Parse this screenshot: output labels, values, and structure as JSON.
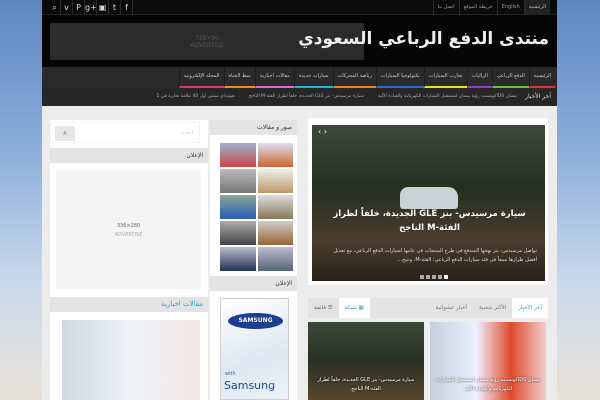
{
  "topbar": {
    "links": [
      "الرئيسية",
      "English",
      "خريطة الموقع",
      "اتصل بنا"
    ],
    "social": [
      "facebook-icon",
      "twitter-icon",
      "youtube-icon",
      "google-plus-icon",
      "pinterest-icon",
      "vimeo-icon",
      "search-icon"
    ]
  },
  "header": {
    "logo": "منتدى الدفع الرباعي السعودي",
    "ad_size": "728×90",
    "ad_label": "ADVERTISE"
  },
  "nav": [
    {
      "label": "الرئيسية",
      "color": "#e0333a"
    },
    {
      "label": "الدفع الرباعي",
      "color": "#6cc04a"
    },
    {
      "label": "الراليات",
      "color": "#8a3fc4"
    },
    {
      "label": "تجارب السيارات",
      "color": "#e8e21e"
    },
    {
      "label": "تكنولوجيا السيارات",
      "color": "#2f69c9"
    },
    {
      "label": "رياضة المحركات",
      "color": "#e88a1e"
    },
    {
      "label": "سيارات جديدة",
      "color": "#1eb8d6"
    },
    {
      "label": "مقالات اخبارية",
      "color": "#e86ad0"
    },
    {
      "label": "نمط الحياة",
      "color": "#f08a1e"
    },
    {
      "label": "المجلة الإلكترونية",
      "color": "#e03366"
    }
  ],
  "ticker": {
    "label": "آخر الأخبار",
    "items": [
      "نيسان IDSكونسبت رؤية نيسان لمستقبل السيارات الكهربائية والقيادة الآلية",
      "سيارة مرسيدس- بنز GLE الجديدة، خلفاً لطراز الفئة-M الناجح",
      "هيونداي سنس أول 40 علامة تجارية في 5"
    ]
  },
  "slider": {
    "title": "سيارة مرسيدس- بنز GLE الجديدة، خلفاً لطراز الفئة-M الناجح",
    "excerpt": "تواصل مرسيدس- بنز نهجها المندفع في طرح المنتجات في عامها لسيارات الدفع الرباعي، مع تعديل أفضل طرازها مبيعاً في فئة سيارات الدفع الرباعي: الفئة-M. وتتيح...",
    "slides": 5,
    "active": 5
  },
  "tabs": {
    "items": [
      "آخر الأخبار",
      "الأكثر شعبية",
      "أخبار عشوائية"
    ],
    "active": 0,
    "views": [
      "شبكة",
      "قائمة"
    ]
  },
  "posts": [
    {
      "title": "نيسان IDSكونسبت رؤية نيسان لمستقبل السيارات الكهربائية والقيادة الآلية"
    },
    {
      "title": "سيارة مرسيدس- بنز GLE الجديدة، خلفاً لطراز الفئة-M الناجح"
    }
  ],
  "middle": {
    "gallery_title": "صور و مقالات",
    "ad_title": "الإعلان",
    "samsung_logo": "SAMSUNG",
    "samsung_with": "with",
    "samsung_brand": "Samsung"
  },
  "left": {
    "search_placeholder": "ابحث",
    "ad_title": "الإعلان",
    "ad_size": "336×280",
    "ad_label": "ADVERTISE",
    "section_title": "مقالات اخبارية"
  }
}
